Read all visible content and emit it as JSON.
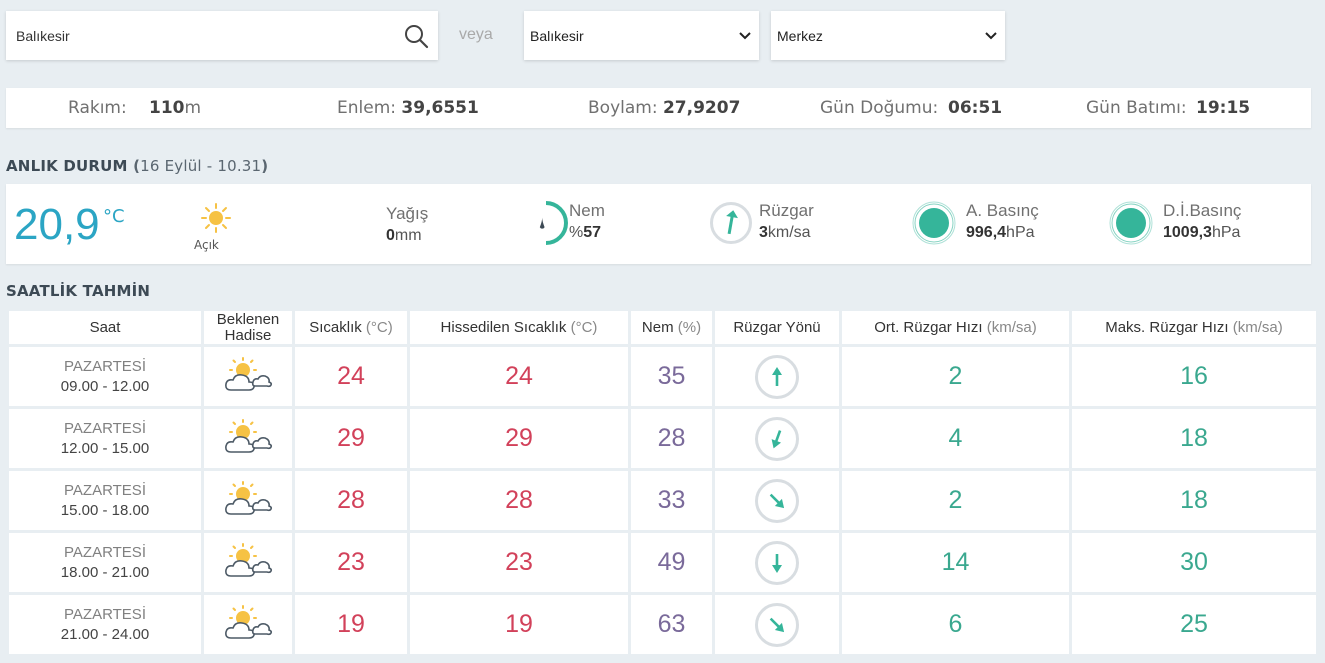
{
  "search": {
    "value": "Balıkesir"
  },
  "veya": "veya",
  "il_select": {
    "selected": "Balıkesir"
  },
  "ilce_select": {
    "selected": "Merkez"
  },
  "info": {
    "rakim_label": "Rakım:",
    "rakim_value": "110",
    "rakim_unit": "m",
    "enlem_label": "Enlem:",
    "enlem_value": "39,6551",
    "boylam_label": "Boylam:",
    "boylam_value": "27,9207",
    "gun_dogumu_label": "Gün Doğumu:",
    "gun_dogumu_value": "06:51",
    "gun_batimi_label": "Gün Batımı:",
    "gun_batimi_value": "19:15"
  },
  "current": {
    "title": "ANLIK DURUM",
    "date": "16 Eylül - 10.31",
    "temperature": "20,9",
    "temp_unit": "°C",
    "condition": "Açık",
    "condition_icon": "sun-icon",
    "yagis_label": "Yağış",
    "yagis_value": "0",
    "yagis_unit": "mm",
    "nem_label": "Nem",
    "nem_prefix": "%",
    "nem_value": "57",
    "ruzgar_label": "Rüzgar",
    "ruzgar_value": "3",
    "ruzgar_unit": "km/sa",
    "abasinc_label": "A. Basınç",
    "abasinc_value": "996,4",
    "abasinc_unit": "hPa",
    "dibasinc_label": "D.İ.Basınç",
    "dibasinc_value": "1009,3",
    "dibasinc_unit": "hPa",
    "colors": {
      "temp": "#2ba5c4",
      "accent": "#35b59a"
    }
  },
  "hourly": {
    "title": "SAATLİK TAHMİN",
    "headers": {
      "saat": "Saat",
      "hadise": "Beklenen Hadise",
      "sicaklik": "Sıcaklık",
      "sicaklik_unit": "(°C)",
      "hissedilen": "Hissedilen Sıcaklık",
      "hissedilen_unit": "(°C)",
      "nem": "Nem",
      "nem_unit": "(%)",
      "yon": "Rüzgar Yönü",
      "ort": "Ort. Rüzgar Hızı",
      "ort_unit": "(km/sa)",
      "maks": "Maks. Rüzgar Hızı",
      "maks_unit": "(km/sa)"
    },
    "rows": [
      {
        "day": "PAZARTESİ",
        "time": "09.00 - 12.00",
        "icon": "partly-cloudy-icon",
        "temp": "24",
        "feels": "24",
        "humidity": "35",
        "wind_dir_deg": 0,
        "avg": "2",
        "max": "16"
      },
      {
        "day": "PAZARTESİ",
        "time": "12.00 - 15.00",
        "icon": "partly-cloudy-icon",
        "temp": "29",
        "feels": "29",
        "humidity": "28",
        "wind_dir_deg": 200,
        "avg": "4",
        "max": "18"
      },
      {
        "day": "PAZARTESİ",
        "time": "15.00 - 18.00",
        "icon": "partly-cloudy-icon",
        "temp": "28",
        "feels": "28",
        "humidity": "33",
        "wind_dir_deg": 135,
        "avg": "2",
        "max": "18"
      },
      {
        "day": "PAZARTESİ",
        "time": "18.00 - 21.00",
        "icon": "partly-cloudy-icon",
        "temp": "23",
        "feels": "23",
        "humidity": "49",
        "wind_dir_deg": 180,
        "avg": "14",
        "max": "30"
      },
      {
        "day": "PAZARTESİ",
        "time": "21.00 - 24.00",
        "icon": "partly-cloudy-icon",
        "temp": "19",
        "feels": "19",
        "humidity": "63",
        "wind_dir_deg": 135,
        "avg": "6",
        "max": "25"
      }
    ]
  }
}
